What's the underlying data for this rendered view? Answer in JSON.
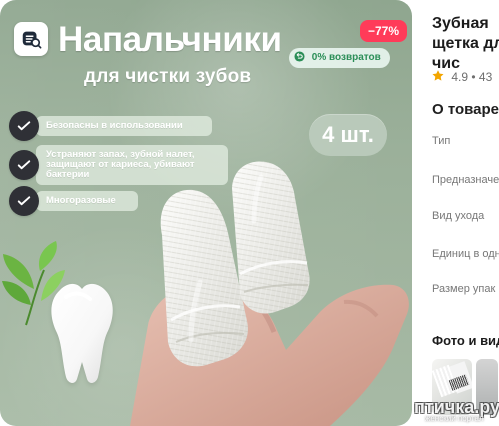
{
  "hero": {
    "title": "Напальчники",
    "subtitle": "для чистки зубов",
    "discount": "−77%",
    "returns": "0% возвратов",
    "count": "4 шт.",
    "benefits": [
      "Безопасны в использовании",
      "Устраняют запах, зубной налет, защищают от кариеса, убивают бактерии",
      "Многоразовые"
    ],
    "icons": {
      "shop": "shop-icon",
      "returns": "return-icon",
      "check": "check-icon",
      "leaves": "leaves-icon",
      "tooth": "tooth-icon"
    },
    "colors": {
      "discount": "#ff3b59",
      "returns_text": "#2b8e57",
      "background": "#9bb09a"
    }
  },
  "sidebar": {
    "title": "Зубная щетка для чис",
    "rating": "4.9 • 43",
    "about": "О товаре",
    "specs": [
      "Тип",
      "Предназначение",
      "Вид ухода",
      "Единиц в одн",
      "Размер упак Ширина х Вы"
    ],
    "photos_title": "Фото и вид"
  },
  "watermark": {
    "main": "птичка.ру",
    "sub": "женский портал"
  }
}
